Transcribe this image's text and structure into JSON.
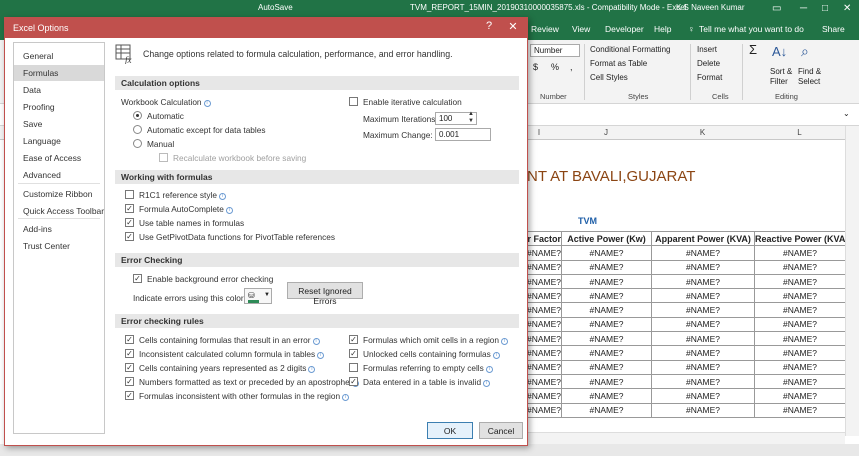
{
  "excel": {
    "title": "TVM_REPORT_15MIN_20190310000035875.xls  -  Compatibility Mode  -  Excel",
    "user": "K S Naveen Kumar",
    "autosave": "AutoSave",
    "tabs": [
      "Review",
      "View",
      "Developer",
      "Help",
      "Tell me what you want to do",
      "Share"
    ],
    "ribbon": {
      "number_format": "Number",
      "currency": "$",
      "percent": "%",
      "comma": ",",
      "conditional_formatting": "Conditional Formatting",
      "format_as_table": "Format as Table",
      "cell_styles": "Cell Styles",
      "insert": "Insert",
      "delete": "Delete",
      "format": "Format",
      "sigma": "Σ",
      "sort_filter": "Sort &",
      "sort_filter2": "Filter",
      "find_select": "Find &",
      "find_select2": "Select",
      "groups": [
        "Number",
        "Styles",
        "Cells",
        "Editing"
      ]
    },
    "columns": [
      "I",
      "J",
      "K",
      "L"
    ],
    "sheet_title": "ANT AT BAVALI,GUJARAT",
    "tvm_label": "TVM",
    "table_headers": [
      "r Factor",
      "Active Power (Kw)",
      "Apparent Power (KVA)",
      "Reactive Power (KVA"
    ],
    "error_value": "#NAME?",
    "row_count": 12
  },
  "dialog": {
    "title": "Excel Options",
    "help": "?",
    "close": "✕",
    "nav": [
      "General",
      "Formulas",
      "Data",
      "Proofing",
      "Save",
      "Language",
      "Ease of Access",
      "Advanced",
      "Customize Ribbon",
      "Quick Access Toolbar",
      "Add-ins",
      "Trust Center"
    ],
    "selected_nav": "Formulas",
    "header": "Change options related to formula calculation, performance, and error handling.",
    "calculation": {
      "section": "Calculation options",
      "workbook_calc": "Workbook Calculation",
      "automatic": "Automatic",
      "automatic_except": "Automatic except for data tables",
      "manual": "Manual",
      "recalc_before_save": "Recalculate workbook before saving",
      "enable_iterative": "Enable iterative calculation",
      "max_iterations_label": "Maximum Iterations:",
      "max_iterations_value": "100",
      "max_change_label": "Maximum Change:",
      "max_change_value": "0.001"
    },
    "working": {
      "section": "Working with formulas",
      "items": [
        {
          "label": "R1C1 reference style",
          "checked": false
        },
        {
          "label": "Formula AutoComplete",
          "checked": true
        },
        {
          "label": "Use table names in formulas",
          "checked": true
        },
        {
          "label": "Use GetPivotData functions for PivotTable references",
          "checked": true
        }
      ]
    },
    "error_checking": {
      "section": "Error Checking",
      "enable_bg": "Enable background error checking",
      "indicate_color": "Indicate errors using this color:",
      "reset_button": "Reset Ignored Errors"
    },
    "rules": {
      "section": "Error checking rules",
      "left": [
        {
          "label": "Cells containing formulas that result in an error",
          "checked": true
        },
        {
          "label": "Inconsistent calculated column formula in tables",
          "checked": true
        },
        {
          "label": "Cells containing years represented as 2 digits",
          "checked": true
        },
        {
          "label": "Numbers formatted as text or preceded by an apostrophe",
          "checked": true
        },
        {
          "label": "Formulas inconsistent with other formulas in the region",
          "checked": true
        }
      ],
      "right": [
        {
          "label": "Formulas which omit cells in a region",
          "checked": true
        },
        {
          "label": "Unlocked cells containing formulas",
          "checked": true
        },
        {
          "label": "Formulas referring to empty cells",
          "checked": false
        },
        {
          "label": "Data entered in a table is invalid",
          "checked": true
        }
      ]
    },
    "ok": "OK",
    "cancel": "Cancel"
  }
}
